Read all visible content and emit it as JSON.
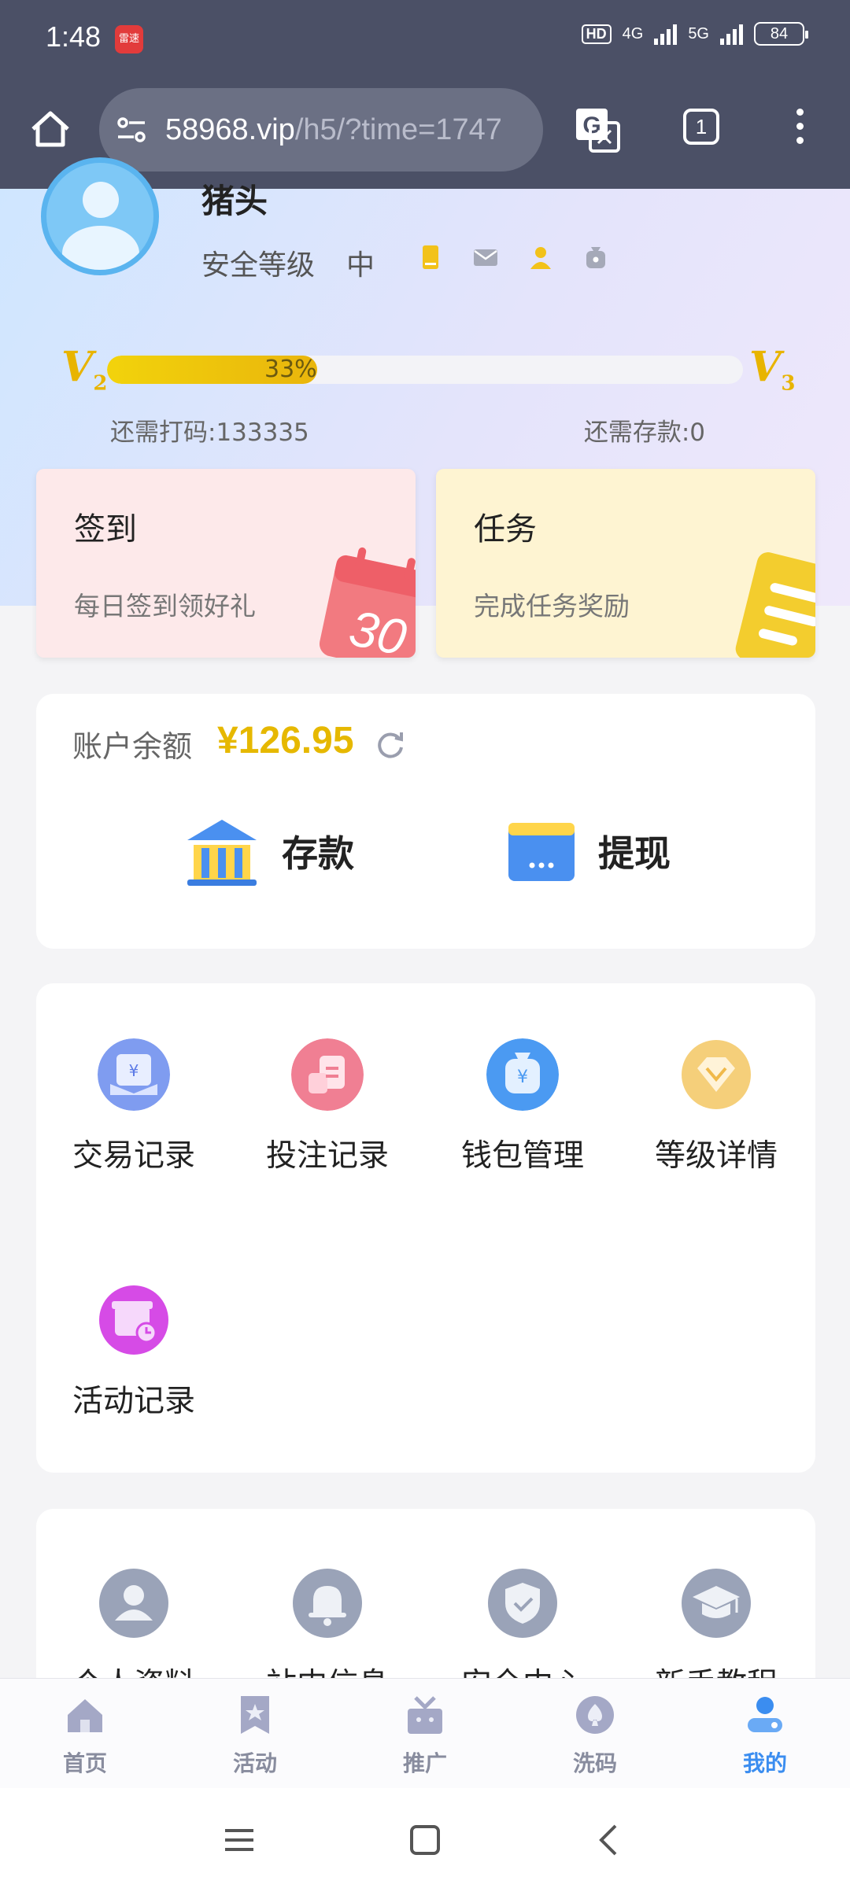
{
  "status": {
    "time": "1:48",
    "app_badge": "雷速",
    "hd": "HD",
    "net1": "4G",
    "net2": "5G",
    "battery": "84"
  },
  "browser": {
    "url_host": "58968.vip",
    "url_path": "/h5/?time=1747",
    "tab_count": "1"
  },
  "profile": {
    "username": "猪头",
    "security_label": "安全等级",
    "security_level": "中",
    "vip_current": "V",
    "vip_current_num": "2",
    "vip_next": "V",
    "vip_next_num": "3",
    "progress_text": "33%",
    "progress_fraction": 0.33,
    "need_bet": "还需打码:133335",
    "need_deposit": "还需存款:0"
  },
  "cards": {
    "signin_title": "签到",
    "signin_sub": "每日签到领好礼",
    "signin_calendar_num": "30",
    "task_title": "任务",
    "task_sub": "完成任务奖励"
  },
  "balance": {
    "label": "账户余额",
    "value": "¥126.95",
    "deposit": "存款",
    "withdraw": "提现"
  },
  "menu1": [
    {
      "label": "交易记录",
      "icon": "transaction-record-icon"
    },
    {
      "label": "投注记录",
      "icon": "bet-record-icon"
    },
    {
      "label": "钱包管理",
      "icon": "wallet-icon"
    },
    {
      "label": "等级详情",
      "icon": "level-diamond-icon"
    },
    {
      "label": "活动记录",
      "icon": "activity-record-icon"
    }
  ],
  "menu2": [
    {
      "label": "个人资料",
      "icon": "profile-icon"
    },
    {
      "label": "站内信息",
      "icon": "bell-icon"
    },
    {
      "label": "安全中心",
      "icon": "shield-icon"
    },
    {
      "label": "新手教程",
      "icon": "graduation-cap-icon"
    }
  ],
  "tabbar": [
    {
      "label": "首页",
      "icon": "home-icon",
      "active": false
    },
    {
      "label": "活动",
      "icon": "activity-star-icon",
      "active": false
    },
    {
      "label": "推广",
      "icon": "gift-promo-icon",
      "active": false
    },
    {
      "label": "洗码",
      "icon": "spade-chip-icon",
      "active": false
    },
    {
      "label": "我的",
      "icon": "user-icon",
      "active": true
    }
  ],
  "colors": {
    "accent_gold": "#e6b800",
    "active_tab": "#3b8df0",
    "chrome": "#4b5066"
  }
}
